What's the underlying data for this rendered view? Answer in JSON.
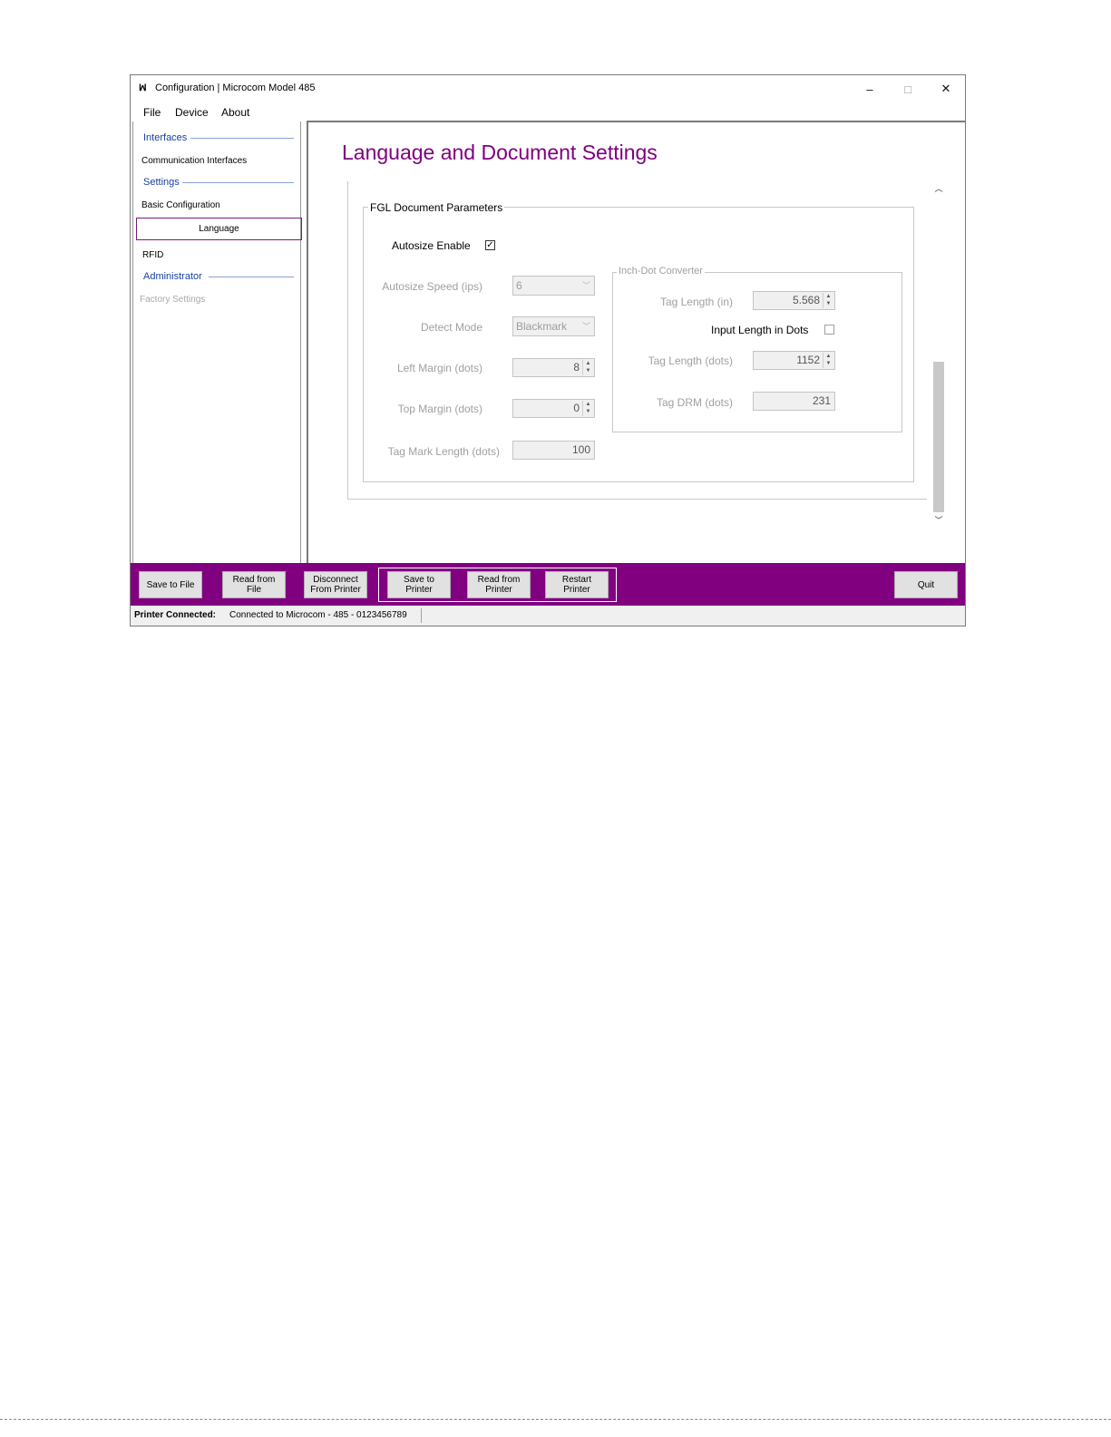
{
  "window": {
    "icon": "ꟽ",
    "title": "Configuration | Microcom Model 485",
    "minimize": "–",
    "maximize": "□",
    "close": "✕"
  },
  "menu": [
    "File",
    "Device",
    "About"
  ],
  "sidebar": {
    "interfaces_heading": "Interfaces",
    "communication_interfaces": "Communication Interfaces",
    "settings_heading": "Settings",
    "basic_configuration": "Basic Configuration",
    "language": "Language",
    "rfid": "RFID",
    "administrator_heading": "Administrator",
    "factory_settings": "Factory Settings"
  },
  "main": {
    "page_title": "Language and Document Settings",
    "group_title": "FGL Document Parameters",
    "autosize_enable_label": "Autosize Enable",
    "autosize_enable_checked": true,
    "autosize_speed_label": "Autosize Speed (ips)",
    "autosize_speed_value": "6",
    "detect_mode_label": "Detect Mode",
    "detect_mode_value": "Blackmark",
    "left_margin_label": "Left Margin (dots)",
    "left_margin_value": "8",
    "top_margin_label": "Top Margin (dots)",
    "top_margin_value": "0",
    "tag_mark_length_label": "Tag Mark Length (dots)",
    "tag_mark_length_value": "100",
    "converter": {
      "title": "Inch-Dot Converter",
      "tag_length_in_label": "Tag Length (in)",
      "tag_length_in_value": "5.568",
      "input_length_in_dots_label": "Input Length in Dots",
      "input_length_in_dots_checked": false,
      "tag_length_dots_label": "Tag Length (dots)",
      "tag_length_dots_value": "1152",
      "tag_drm_label": "Tag DRM (dots)",
      "tag_drm_value": "231"
    }
  },
  "toolbar": {
    "save_to_file": "Save to File",
    "read_from_file_1": "Read from",
    "read_from_file_2": "File",
    "disconnect_1": "Disconnect",
    "disconnect_2": "From Printer",
    "save_to_printer_1": "Save to",
    "save_to_printer_2": "Printer",
    "read_from_printer_1": "Read from",
    "read_from_printer_2": "Printer",
    "restart_printer_1": "Restart",
    "restart_printer_2": "Printer",
    "quit": "Quit"
  },
  "status": {
    "label": "Printer Connected:",
    "value": "Connected to Microcom - 485 - 0123456789"
  },
  "colors": {
    "accent": "#800080",
    "sidebar_heading": "#1a3fa0"
  }
}
